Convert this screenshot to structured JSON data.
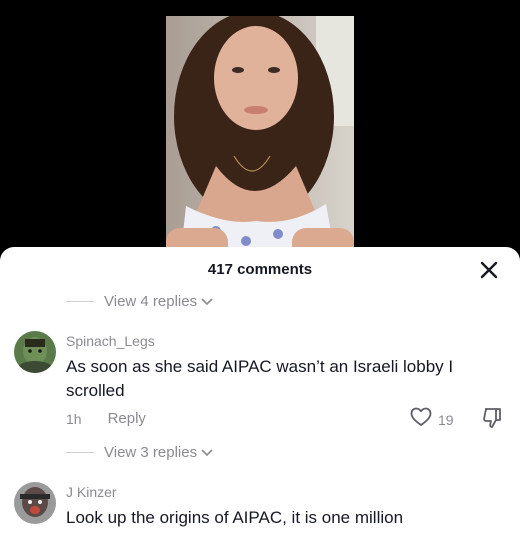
{
  "video": {
    "description_icon": "video-thumbnail"
  },
  "sheet": {
    "title": "417 comments"
  },
  "replies_toggle_1": {
    "label": "View 4 replies"
  },
  "comment_1": {
    "username": "Spinach_Legs",
    "text": "As soon as she said AIPAC wasn’t an Israeli lobby I scrolled",
    "time": "1h",
    "reply_label": "Reply",
    "likes": "19"
  },
  "replies_toggle_2": {
    "label": "View 3 replies"
  },
  "comment_2": {
    "username": "J Kinzer",
    "text": "Look up the origins of AIPAC, it is one million"
  },
  "colors": {
    "sheet_bg": "#ffffff",
    "text_primary": "#161823",
    "text_secondary": "#8a8b91"
  },
  "icons": [
    "close-icon",
    "chevron-down-icon",
    "heart-icon",
    "dislike-icon"
  ]
}
